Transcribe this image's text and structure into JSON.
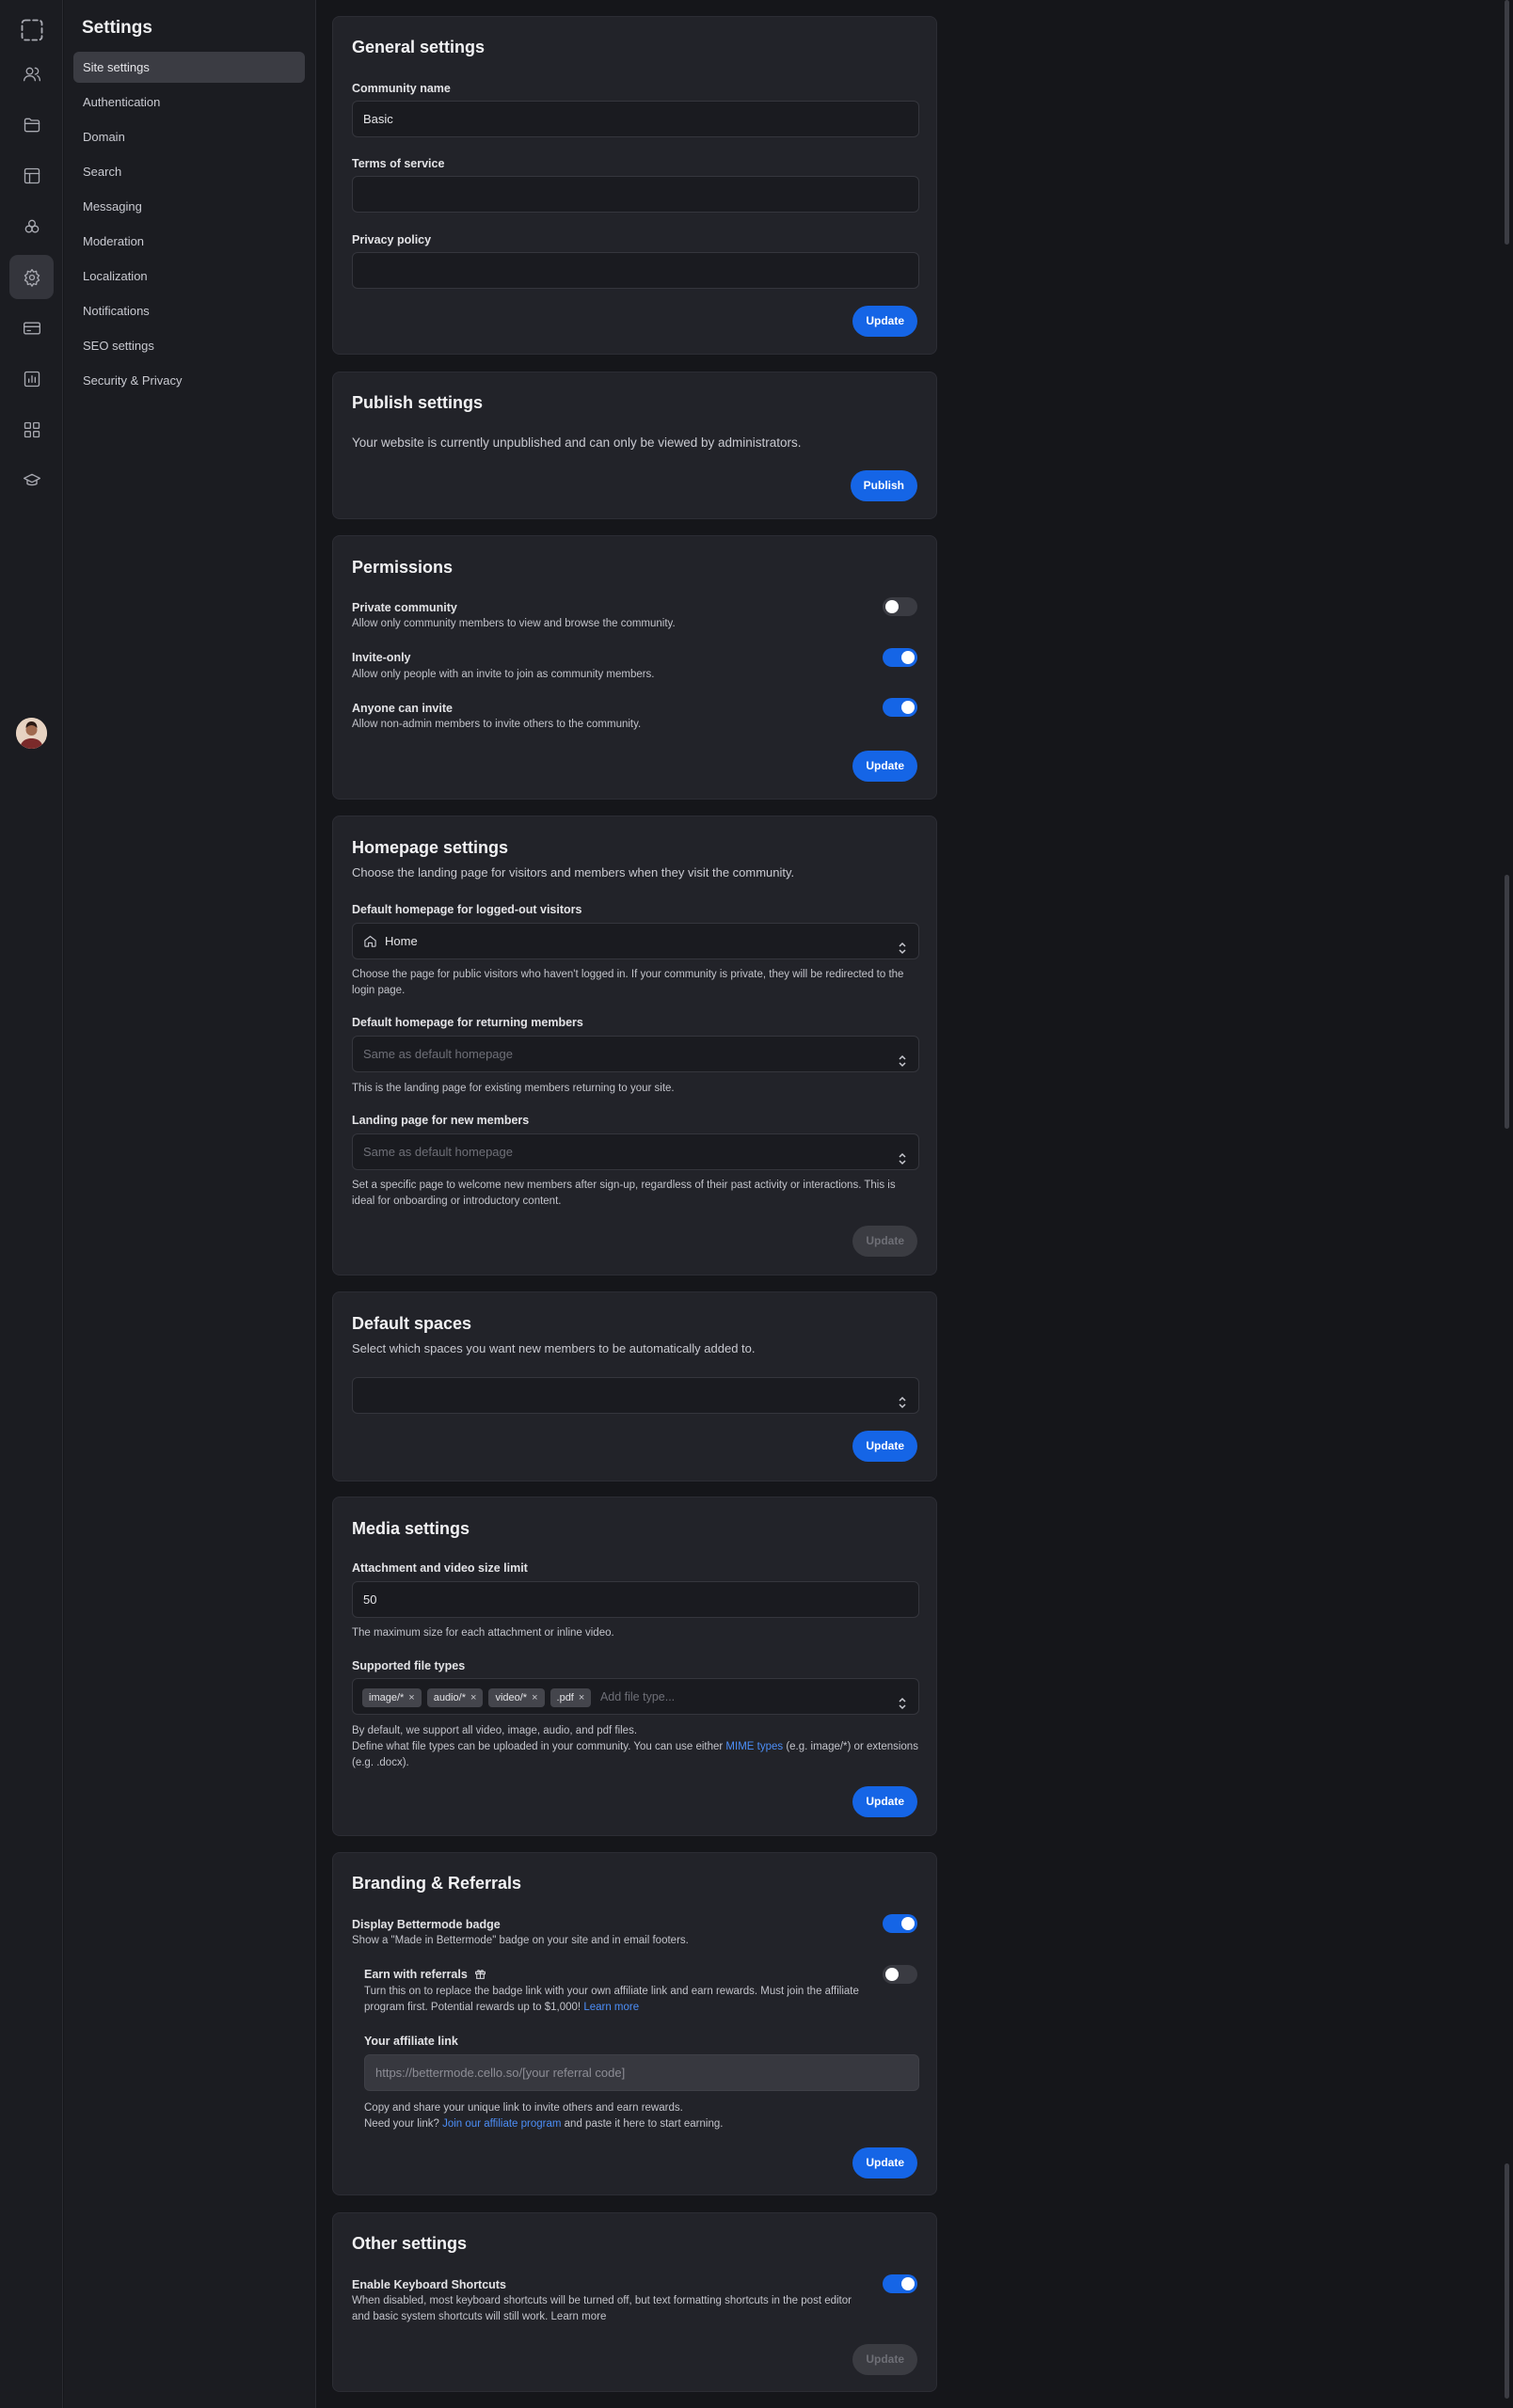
{
  "rail": {
    "items": [
      "dashed-square-icon",
      "members-icon",
      "folder-icon",
      "layout-icon",
      "shapes-icon",
      "settings-gear-icon",
      "billing-card-icon",
      "analytics-chart-icon",
      "apps-grid-icon",
      "academy-cap-icon"
    ],
    "active": "settings-gear-icon"
  },
  "subnav": {
    "title": "Settings",
    "items": [
      {
        "label": "Site settings",
        "active": true
      },
      {
        "label": "Authentication"
      },
      {
        "label": "Domain"
      },
      {
        "label": "Search"
      },
      {
        "label": "Messaging"
      },
      {
        "label": "Moderation"
      },
      {
        "label": "Localization"
      },
      {
        "label": "Notifications"
      },
      {
        "label": "SEO settings"
      },
      {
        "label": "Security & Privacy"
      }
    ]
  },
  "general": {
    "title": "General settings",
    "community_name_label": "Community name",
    "community_name_value": "Basic",
    "tos_label": "Terms of service",
    "privacy_label": "Privacy policy",
    "update": "Update"
  },
  "publish": {
    "title": "Publish settings",
    "text": "Your website is currently unpublished and can only be viewed by administrators.",
    "button": "Publish"
  },
  "permissions": {
    "title": "Permissions",
    "items": [
      {
        "label": "Private community",
        "desc": "Allow only community members to view and browse the community.",
        "on": false
      },
      {
        "label": "Invite-only",
        "desc": "Allow only people with an invite to join as community members.",
        "on": true
      },
      {
        "label": "Anyone can invite",
        "desc": "Allow non-admin members to invite others to the community.",
        "on": true
      }
    ],
    "update": "Update"
  },
  "homepage": {
    "title": "Homepage settings",
    "subtitle": "Choose the landing page for visitors and members when they visit the community.",
    "logged_out_label": "Default homepage for logged-out visitors",
    "logged_out_value": "Home",
    "logged_out_help": "Choose the page for public visitors who haven't logged in. If your community is private, they will be redirected to the login page.",
    "returning_label": "Default homepage for returning members",
    "returning_placeholder": "Same as default homepage",
    "returning_help": "This is the landing page for existing members returning to your site.",
    "new_label": "Landing page for new members",
    "new_placeholder": "Same as default homepage",
    "new_help": "Set a specific page to welcome new members after sign-up, regardless of their past activity or interactions. This is ideal for onboarding or introductory content.",
    "update": "Update"
  },
  "spaces": {
    "title": "Default spaces",
    "subtitle": "Select which spaces you want new members to be automatically added to.",
    "update": "Update"
  },
  "media": {
    "title": "Media settings",
    "size_label": "Attachment and video size limit",
    "size_value": "50",
    "size_help": "The maximum size for each attachment or inline video.",
    "types_label": "Supported file types",
    "tags": [
      "image/*",
      "audio/*",
      "video/*",
      ".pdf"
    ],
    "types_placeholder": "Add file type...",
    "help1": "By default, we support all video, image, audio, and pdf files.",
    "help2_pre": "Define what file types can be uploaded in your community. You can use either ",
    "help2_link": "MIME types",
    "help2_post": " (e.g. image/*) or extensions (e.g. .docx).",
    "update": "Update"
  },
  "branding": {
    "title": "Branding & Referrals",
    "badge_label": "Display Bettermode badge",
    "badge_desc": "Show a \"Made in Bettermode\" badge on your site and in email footers.",
    "badge_on": true,
    "earn_label": "Earn with referrals",
    "earn_desc": "Turn this on to replace the badge link with your own affiliate link and earn rewards. Must join the affiliate program first. Potential rewards up to $1,000!",
    "earn_link": "Learn more",
    "earn_on": false,
    "affiliate_label": "Your affiliate link",
    "affiliate_placeholder": "https://bettermode.cello.so/[your referral code]",
    "help1": "Copy and share your unique link to invite others and earn rewards.",
    "help2_pre": "Need your link? ",
    "help2_link": "Join our affiliate program",
    "help2_post": " and paste it here to start earning.",
    "update": "Update"
  },
  "other": {
    "title": "Other settings",
    "shortcuts_label": "Enable Keyboard Shortcuts",
    "shortcuts_desc": "When disabled, most keyboard shortcuts will be turned off, but text formatting shortcuts in the post editor and basic system shortcuts will still work. Learn more",
    "shortcuts_on": true,
    "update": "Update"
  }
}
